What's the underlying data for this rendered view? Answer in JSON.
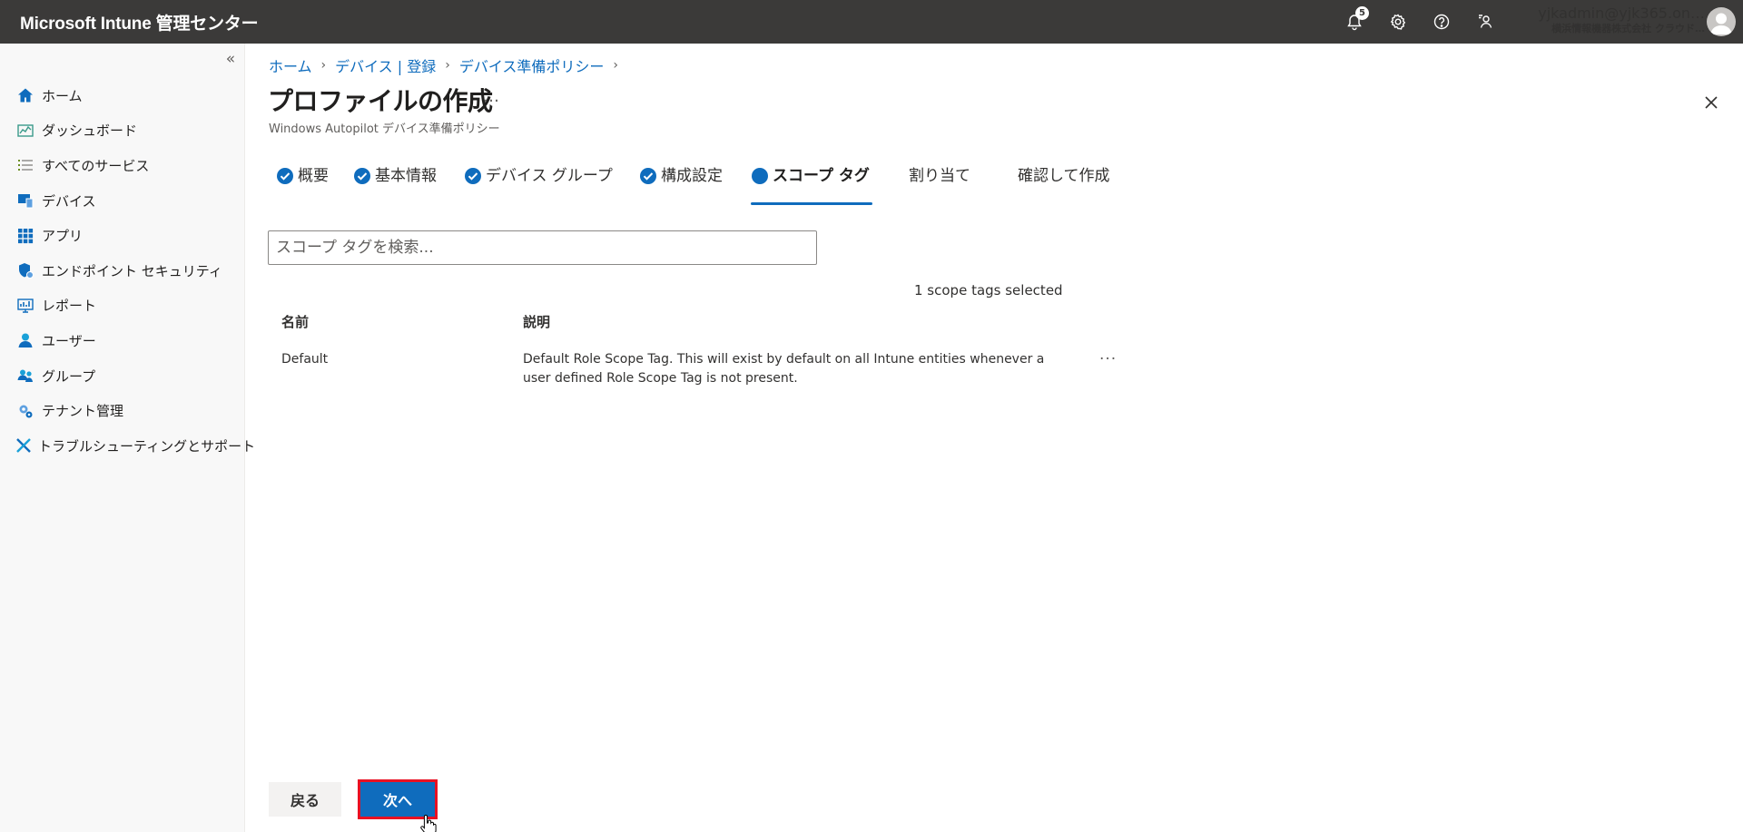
{
  "header": {
    "app_title": "Microsoft Intune 管理センター",
    "notification_count": "5",
    "account_email": "yjkadmin@yjk365.on…",
    "account_org": "横浜情報機器株式会社 クラウド…"
  },
  "sidebar": {
    "collapse_label": "«",
    "items": [
      {
        "label": "ホーム",
        "icon": "home-icon"
      },
      {
        "label": "ダッシュボード",
        "icon": "dashboard-icon"
      },
      {
        "label": "すべてのサービス",
        "icon": "all-services-icon"
      },
      {
        "label": "デバイス",
        "icon": "devices-icon"
      },
      {
        "label": "アプリ",
        "icon": "apps-icon"
      },
      {
        "label": "エンドポイント セキュリティ",
        "icon": "shield-icon"
      },
      {
        "label": "レポート",
        "icon": "reports-icon"
      },
      {
        "label": "ユーザー",
        "icon": "user-icon"
      },
      {
        "label": "グループ",
        "icon": "group-icon"
      },
      {
        "label": "テナント管理",
        "icon": "tenant-admin-icon"
      },
      {
        "label": "トラブルシューティングとサポート",
        "icon": "troubleshoot-icon"
      }
    ]
  },
  "breadcrumb": [
    "ホーム",
    "デバイス | 登録",
    "デバイス準備ポリシー"
  ],
  "page": {
    "title": "プロファイルの作成",
    "more": "…",
    "subtitle": "Windows Autopilot デバイス準備ポリシー"
  },
  "steps": [
    {
      "label": "概要",
      "status": "done"
    },
    {
      "label": "基本情報",
      "status": "done"
    },
    {
      "label": "デバイス グループ",
      "status": "done"
    },
    {
      "label": "構成設定",
      "status": "done"
    },
    {
      "label": "スコープ タグ",
      "status": "active"
    },
    {
      "label": "割り当て",
      "status": "pending"
    },
    {
      "label": "確認して作成",
      "status": "pending"
    }
  ],
  "search": {
    "placeholder": "スコープ タグを検索..."
  },
  "selected_count": "1 scope tags selected",
  "table": {
    "columns": [
      "名前",
      "説明"
    ],
    "rows": [
      {
        "name": "Default",
        "description_line1": "Default Role Scope Tag. This will exist by default on all Intune entities whenever a",
        "description_line2": "user defined Role Scope Tag is not present.",
        "more": "···"
      }
    ]
  },
  "footer": {
    "back_label": "戻る",
    "next_label": "次へ"
  },
  "colors": {
    "accent": "#0f6cbd",
    "topbar": "#3b3a39",
    "highlight": "#e81123"
  }
}
